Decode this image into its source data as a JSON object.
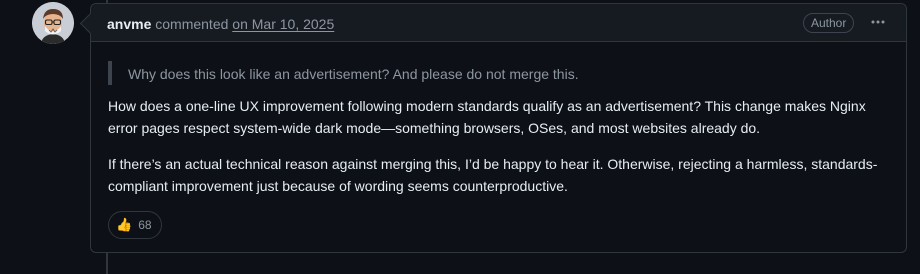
{
  "comment": {
    "author": "anvme",
    "action": "commented",
    "date": "on Mar 10, 2025",
    "badge": "Author",
    "menu_icon": "kebab-horizontal-icon",
    "quote": "Why does this look like an advertisement? And please do not merge this.",
    "paragraphs": [
      "How does a one-line UX improvement following modern standards qualify as an advertisement? This change makes Nginx error pages respect system-wide dark mode—something browsers, OSes, and most websites already do.",
      "If there’s an actual technical reason against merging this, I’d be happy to hear it. Otherwise, rejecting a harmless, standards-compliant improvement just because of wording seems counterproductive."
    ],
    "reactions": [
      {
        "emoji": "👍",
        "icon": "thumbs-up-icon",
        "count": "68"
      }
    ]
  },
  "colors": {
    "background": "#0d1117",
    "header_background": "#161b22",
    "border": "#30363d",
    "text_primary": "#e6edf3",
    "text_muted": "#8d96a0"
  }
}
